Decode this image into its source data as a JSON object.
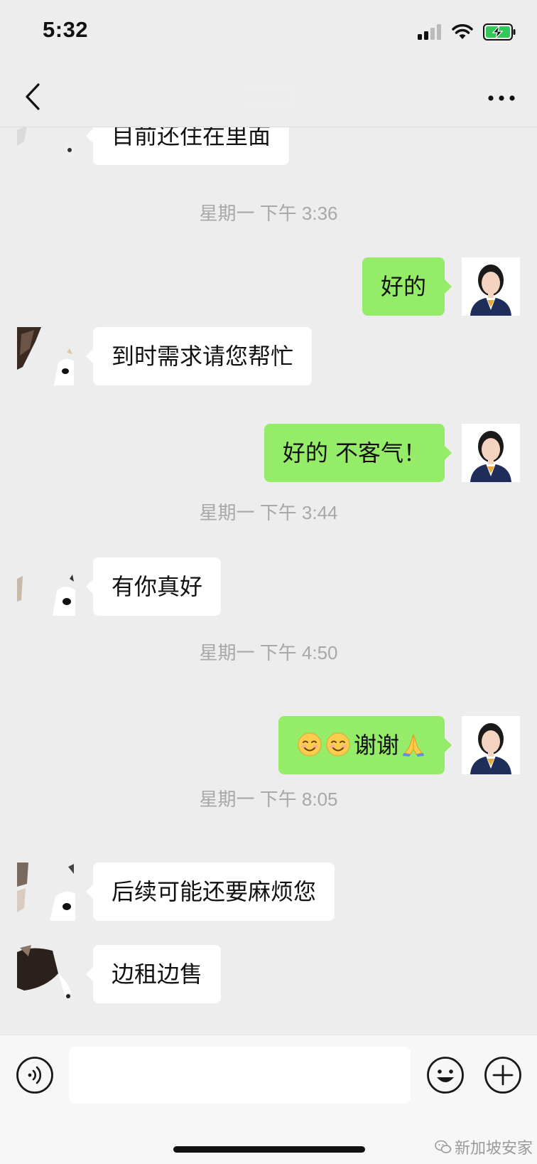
{
  "status_bar": {
    "time": "5:32",
    "icons": [
      "cellular-signal-icon",
      "wifi-icon",
      "battery-charging-icon"
    ],
    "battery_color": "#34c759"
  },
  "nav": {
    "title": "",
    "icons": [
      "back-chevron-icon",
      "more-dots-icon"
    ]
  },
  "messages": [
    {
      "type": "in",
      "text": "目前还住在里面"
    },
    {
      "type": "time",
      "text": "星期一 下午 3:36"
    },
    {
      "type": "out",
      "text": "好的"
    },
    {
      "type": "in",
      "text": "到时需求请您帮忙"
    },
    {
      "type": "out",
      "text": "好的 不客气！"
    },
    {
      "type": "time",
      "text": "星期一 下午 3:44"
    },
    {
      "type": "in",
      "text": "有你真好"
    },
    {
      "type": "time",
      "text": "星期一 下午 4:50"
    },
    {
      "type": "out",
      "text": "谢谢",
      "emoji": [
        "smiling-face-icon",
        "smiling-face-icon",
        "folded-hands-icon"
      ]
    },
    {
      "type": "time",
      "text": "星期一 下午 8:05"
    },
    {
      "type": "in",
      "text": "后续可能还要麻烦您"
    },
    {
      "type": "in",
      "text": "边租边售"
    }
  ],
  "input_bar": {
    "placeholder": "",
    "icons": [
      "voice-icon",
      "emoji-smiley-icon",
      "add-plus-icon"
    ]
  },
  "watermark": {
    "text": "新加坡安家",
    "icon": "wechat-logo-icon"
  },
  "colors": {
    "background": "#ededed",
    "bubble_out": "#95ec69",
    "bubble_in": "#ffffff",
    "timestamp": "#a8a8a8"
  }
}
